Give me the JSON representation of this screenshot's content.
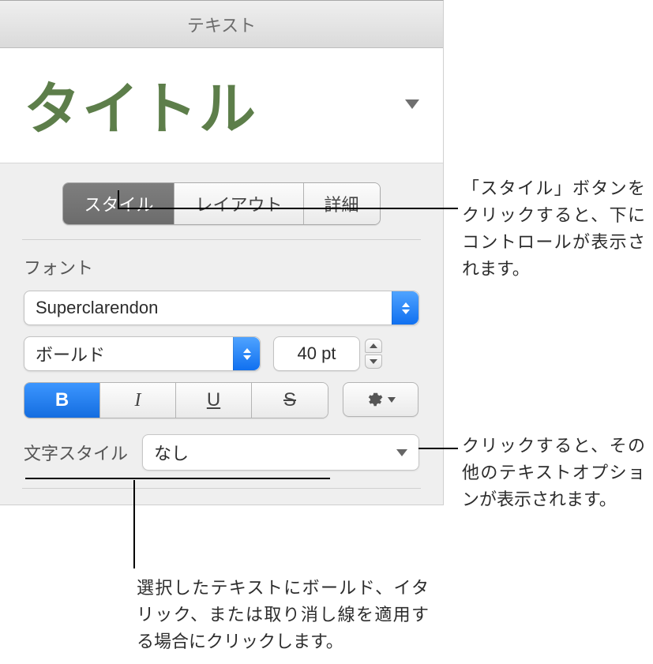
{
  "header": {
    "title": "テキスト"
  },
  "paragraph_style": {
    "name": "タイトル"
  },
  "tabs": {
    "style": "スタイル",
    "layout": "レイアウト",
    "advanced": "詳細"
  },
  "font": {
    "section_label": "フォント",
    "family": "Superclarendon",
    "weight": "ボールド",
    "size": "40 pt"
  },
  "bius": {
    "b": "B",
    "i": "I",
    "u": "U",
    "s": "S"
  },
  "character_style": {
    "label": "文字スタイル",
    "value": "なし"
  },
  "callouts": {
    "style_button": "「スタイル」ボタンをクリックすると、下にコントロールが表示されます。",
    "gear_button": "クリックすると、その他のテキストオプションが表示されます。",
    "bius_group": "選択したテキストにボールド、イタリック、または取り消し線を適用する場合にクリックします。"
  }
}
